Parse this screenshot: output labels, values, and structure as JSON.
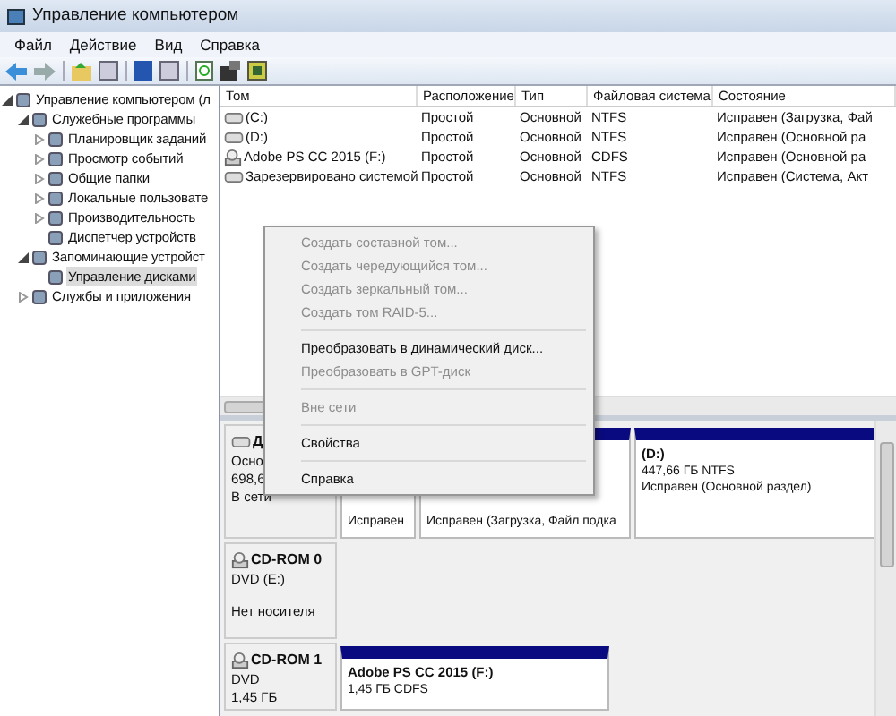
{
  "window": {
    "title": "Управление компьютером"
  },
  "menu": [
    "Файл",
    "Действие",
    "Вид",
    "Справка"
  ],
  "tree": [
    {
      "label": "Управление компьютером (л",
      "expanded": true,
      "selected": false,
      "children": [
        {
          "label": "Служебные программы",
          "expanded": true,
          "selected": false,
          "children": [
            {
              "label": "Планировщик заданий",
              "expanded": false,
              "selected": false
            },
            {
              "label": "Просмотр событий",
              "expanded": false,
              "selected": false
            },
            {
              "label": "Общие папки",
              "expanded": false,
              "selected": false
            },
            {
              "label": "Локальные пользовате",
              "expanded": false,
              "selected": false
            },
            {
              "label": "Производительность",
              "expanded": false,
              "selected": false
            },
            {
              "label": "Диспетчер устройств",
              "selected": false
            }
          ]
        },
        {
          "label": "Запоминающие устройст",
          "expanded": true,
          "selected": false,
          "children": [
            {
              "label": "Управление дисками",
              "selected": true
            }
          ]
        },
        {
          "label": "Службы и приложения",
          "expanded": false,
          "selected": false
        }
      ]
    }
  ],
  "table": {
    "columns": [
      "Том",
      "Расположение",
      "Тип",
      "Файловая система",
      "Состояние"
    ],
    "rows": [
      {
        "kind": "disk",
        "cells": [
          "(C:)",
          "Простой",
          "Основной",
          "NTFS",
          "Исправен (Загрузка, Фай"
        ]
      },
      {
        "kind": "disk",
        "cells": [
          "(D:)",
          "Простой",
          "Основной",
          "NTFS",
          "Исправен (Основной ра"
        ]
      },
      {
        "kind": "cd",
        "cells": [
          "Adobe PS CC 2015 (F:)",
          "Простой",
          "Основной",
          "CDFS",
          "Исправен (Основной ра"
        ]
      },
      {
        "kind": "disk",
        "cells": [
          "Зарезервировано системой",
          "Простой",
          "Основной",
          "NTFS",
          "Исправен (Система, Акт"
        ]
      }
    ]
  },
  "disks": [
    {
      "kind": "disk",
      "name": "Д",
      "lines": [
        "Осно",
        "698,6",
        "В сети"
      ],
      "partitions": [
        {
          "lines": [
            "Исправен"
          ]
        },
        {
          "lines": [
            "Исправен (Загрузка, Файл подка"
          ]
        },
        {
          "title": "(D:)",
          "lines": [
            "447,66 ГБ NTFS",
            "Исправен (Основной раздел)"
          ]
        }
      ]
    },
    {
      "kind": "cd",
      "name": "CD-ROM 0",
      "lines": [
        "DVD (E:)",
        "Нет носителя"
      ]
    },
    {
      "kind": "cd",
      "name": "CD-ROM 1",
      "lines": [
        "DVD",
        "1,45 ГБ"
      ],
      "partitions": [
        {
          "title": "Adobe PS CC 2015  (F:)",
          "lines": [
            "1,45 ГБ CDFS"
          ]
        }
      ]
    }
  ],
  "context_menu": [
    {
      "kind": "item",
      "label": "Создать составной том...",
      "disabled": true
    },
    {
      "kind": "item",
      "label": "Создать чередующийся том...",
      "disabled": true
    },
    {
      "kind": "item",
      "label": "Создать зеркальный том...",
      "disabled": true
    },
    {
      "kind": "item",
      "label": "Создать том RAID-5...",
      "disabled": true
    },
    {
      "kind": "separator"
    },
    {
      "kind": "item",
      "label": "Преобразовать в динамический диск...",
      "disabled": false
    },
    {
      "kind": "item",
      "label": "Преобразовать в GPT-диск",
      "disabled": true
    },
    {
      "kind": "separator"
    },
    {
      "kind": "item",
      "label": "Вне сети",
      "disabled": true
    },
    {
      "kind": "separator"
    },
    {
      "kind": "item",
      "label": "Свойства",
      "disabled": false
    },
    {
      "kind": "separator"
    },
    {
      "kind": "item",
      "label": "Справка",
      "disabled": false
    }
  ]
}
